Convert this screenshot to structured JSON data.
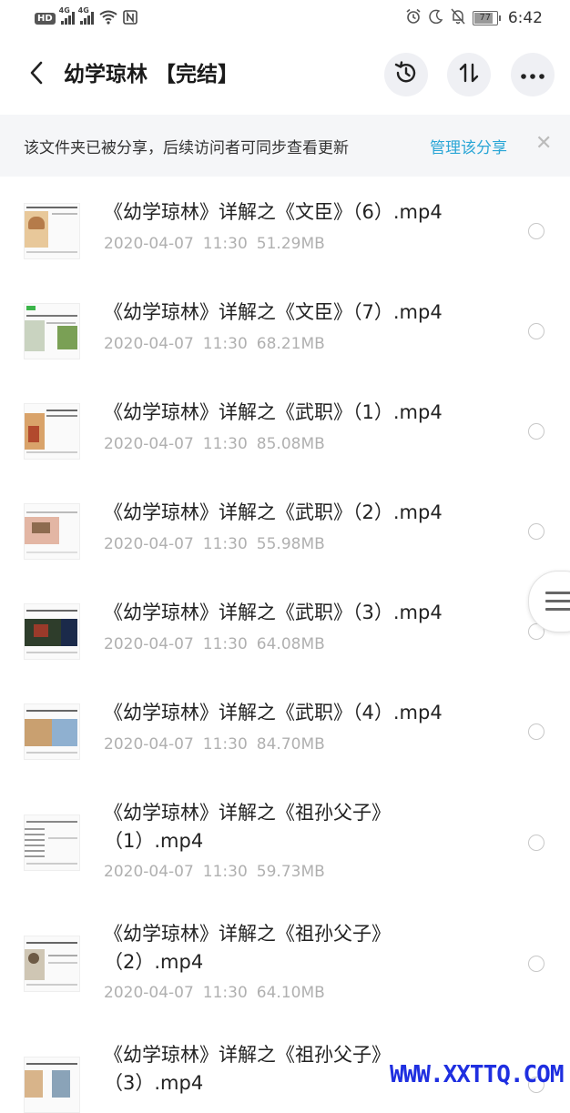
{
  "status_bar": {
    "hd": "HD",
    "net1": "4G",
    "net2": "4G",
    "battery": "77",
    "time": "6:42"
  },
  "header": {
    "back_icon": "chevron-left-icon",
    "title": "幼学琼林 【完结】",
    "history_icon": "history-icon",
    "sort_icon": "sort-icon",
    "more_icon": "more-icon"
  },
  "banner": {
    "text": "该文件夹已被分享，后续访问者可同步查看更新",
    "link": "管理该分享",
    "close": "✕"
  },
  "files": [
    {
      "line1": "《幼学琼林》详解之《文臣》（6）.mp4",
      "line2": "",
      "date": "2020-04-07",
      "time": "11:30",
      "size": "51.29MB"
    },
    {
      "line1": "《幼学琼林》详解之《文臣》（7）.mp4",
      "line2": "",
      "date": "2020-04-07",
      "time": "11:30",
      "size": "68.21MB"
    },
    {
      "line1": "《幼学琼林》详解之《武职》（1）.mp4",
      "line2": "",
      "date": "2020-04-07",
      "time": "11:30",
      "size": "85.08MB"
    },
    {
      "line1": "《幼学琼林》详解之《武职》（2）.mp4",
      "line2": "",
      "date": "2020-04-07",
      "time": "11:30",
      "size": "55.98MB"
    },
    {
      "line1": "《幼学琼林》详解之《武职》（3）.mp4",
      "line2": "",
      "date": "2020-04-07",
      "time": "11:30",
      "size": "64.08MB"
    },
    {
      "line1": "《幼学琼林》详解之《武职》（4）.mp4",
      "line2": "",
      "date": "2020-04-07",
      "time": "11:30",
      "size": "84.70MB"
    },
    {
      "line1": "《幼学琼林》详解之《祖孙父子》",
      "line2": "（1）.mp4",
      "date": "2020-04-07",
      "time": "11:30",
      "size": "59.73MB"
    },
    {
      "line1": "《幼学琼林》详解之《祖孙父子》",
      "line2": "（2）.mp4",
      "date": "2020-04-07",
      "time": "11:30",
      "size": "64.10MB"
    },
    {
      "line1": "《幼学琼林》详解之《祖孙父子》",
      "line2": "（3）.mp4",
      "date": "",
      "time": "",
      "size": ""
    }
  ],
  "watermark": "WWW.XXTTQ.COM"
}
